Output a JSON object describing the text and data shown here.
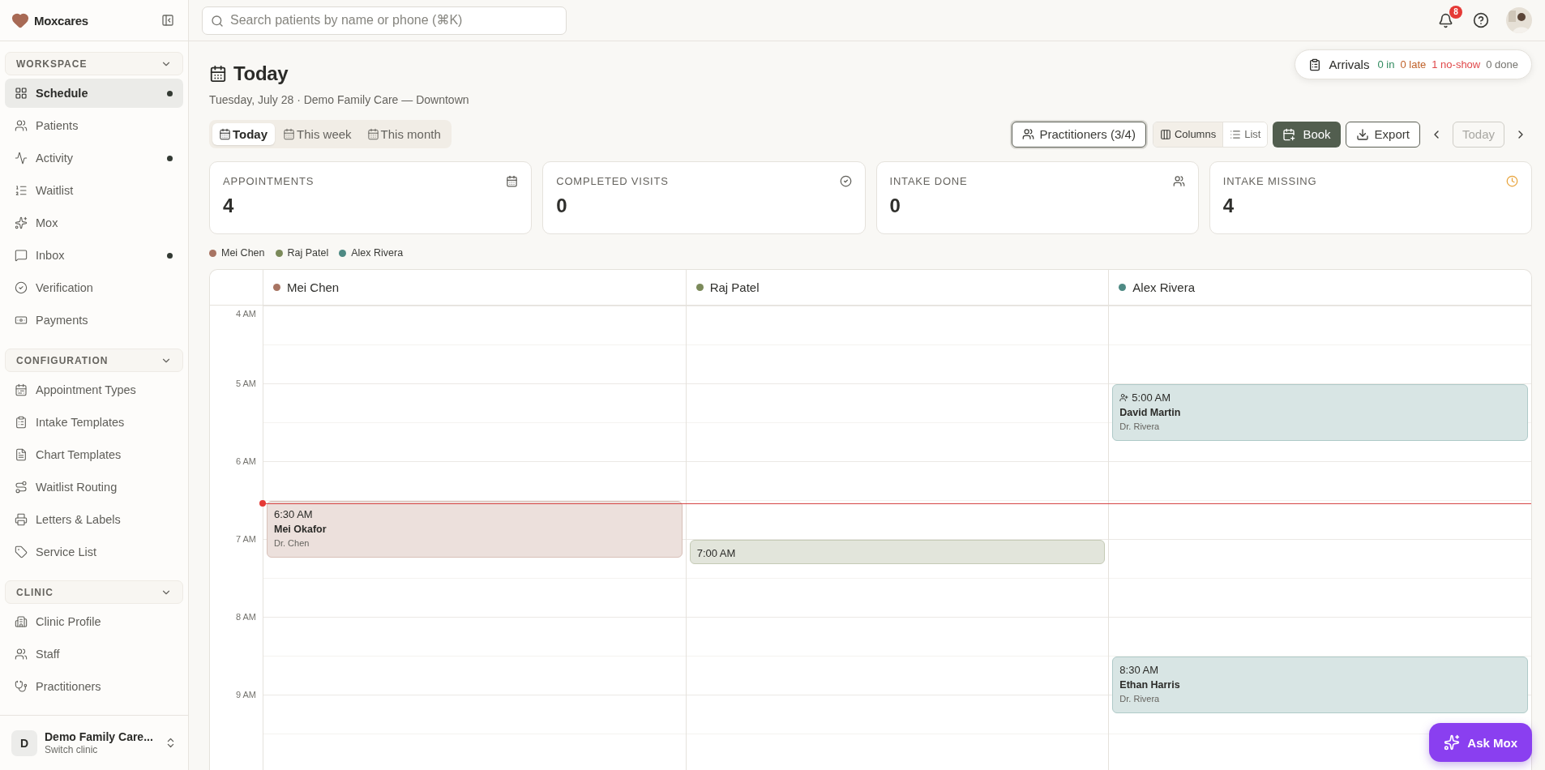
{
  "sidebar": {
    "brand": "Moxcares",
    "sections": [
      {
        "title": "WORKSPACE",
        "expanded": true,
        "items": [
          {
            "label": "Schedule",
            "selected": true,
            "unread": true
          },
          {
            "label": "Patients",
            "selected": false,
            "unread": false
          },
          {
            "label": "Activity",
            "selected": false,
            "unread": true
          },
          {
            "label": "Waitlist",
            "selected": false,
            "unread": false
          },
          {
            "label": "Mox",
            "selected": false,
            "unread": false
          },
          {
            "label": "Inbox",
            "selected": false,
            "unread": true
          },
          {
            "label": "Verification",
            "selected": false,
            "unread": false
          },
          {
            "label": "Payments",
            "selected": false,
            "unread": false
          }
        ]
      },
      {
        "title": "CONFIGURATION",
        "expanded": true,
        "items": [
          {
            "label": "Appointment Types",
            "selected": false,
            "unread": false
          },
          {
            "label": "Intake Templates",
            "selected": false,
            "unread": false
          },
          {
            "label": "Chart Templates",
            "selected": false,
            "unread": false
          },
          {
            "label": "Waitlist Routing",
            "selected": false,
            "unread": false
          },
          {
            "label": "Letters & Labels",
            "selected": false,
            "unread": false
          },
          {
            "label": "Service List",
            "selected": false,
            "unread": false
          }
        ]
      },
      {
        "title": "CLINIC",
        "expanded": true,
        "items": [
          {
            "label": "Clinic Profile",
            "selected": false,
            "unread": false
          },
          {
            "label": "Staff",
            "selected": false,
            "unread": false
          },
          {
            "label": "Practitioners",
            "selected": false,
            "unread": false
          }
        ]
      }
    ],
    "clinic": {
      "initial": "D",
      "name": "Demo Family Care...",
      "subtitle": "Switch clinic"
    }
  },
  "header": {
    "search": {
      "placeholder": "Search patients by name or phone (⌘K)"
    },
    "notifications": "8"
  },
  "page": {
    "title": "Today",
    "subtitle": "Tuesday, July 28 · Demo Family Care — Downtown",
    "arrivals": {
      "label": "Arrivals",
      "counts": [
        {
          "text": "0 in",
          "kind": "in"
        },
        {
          "text": "0 late",
          "kind": "late"
        },
        {
          "text": "1 no-show",
          "kind": "no_show"
        },
        {
          "text": "0 done",
          "kind": "done"
        }
      ]
    }
  },
  "range_tabs": [
    {
      "label": "Today",
      "selected": true
    },
    {
      "label": "This week",
      "selected": false
    },
    {
      "label": "This month",
      "selected": false
    }
  ],
  "toolbar": {
    "practitioners": "Practitioners (3/4)",
    "views": [
      {
        "label": "Columns",
        "selected": true
      },
      {
        "label": "List",
        "selected": false
      }
    ],
    "book": "Book",
    "export": "Export",
    "today": {
      "label": "Today",
      "disabled": true
    }
  },
  "stats": [
    {
      "label": "APPOINTMENTS",
      "value": "4"
    },
    {
      "label": "COMPLETED VISITS",
      "value": "0"
    },
    {
      "label": "INTAKE DONE",
      "value": "0"
    },
    {
      "label": "INTAKE MISSING",
      "value": "4"
    }
  ],
  "legend": [
    {
      "name": "Mei Chen",
      "color": "#a87462"
    },
    {
      "name": "Raj Patel",
      "color": "#7b8a5a"
    },
    {
      "name": "Alex Rivera",
      "color": "#4e8a84"
    }
  ],
  "calendar": {
    "hours": [
      "4 AM",
      "5 AM",
      "6 AM",
      "7 AM",
      "8 AM",
      "9 AM"
    ],
    "now_line": true,
    "columns": [
      {
        "name": "Mei Chen",
        "color": "#a87462",
        "events": [
          {
            "time": "6:30 AM",
            "patient": "Mei Okafor",
            "doctor": "Dr. Chen",
            "kind": "standard",
            "new_patient": false
          }
        ]
      },
      {
        "name": "Raj Patel",
        "color": "#7b8a5a",
        "events": [
          {
            "time": "7:00 AM",
            "kind": "short",
            "new_patient": false
          }
        ]
      },
      {
        "name": "Alex Rivera",
        "color": "#4e8a84",
        "events": [
          {
            "time": "5:00 AM",
            "patient": "David Martin",
            "doctor": "Dr. Rivera",
            "kind": "standard",
            "new_patient": true
          },
          {
            "time": "8:30 AM",
            "patient": "Ethan Harris",
            "doctor": "Dr. Rivera",
            "kind": "standard",
            "new_patient": false
          }
        ]
      }
    ]
  },
  "ask_button": "Ask Mox"
}
